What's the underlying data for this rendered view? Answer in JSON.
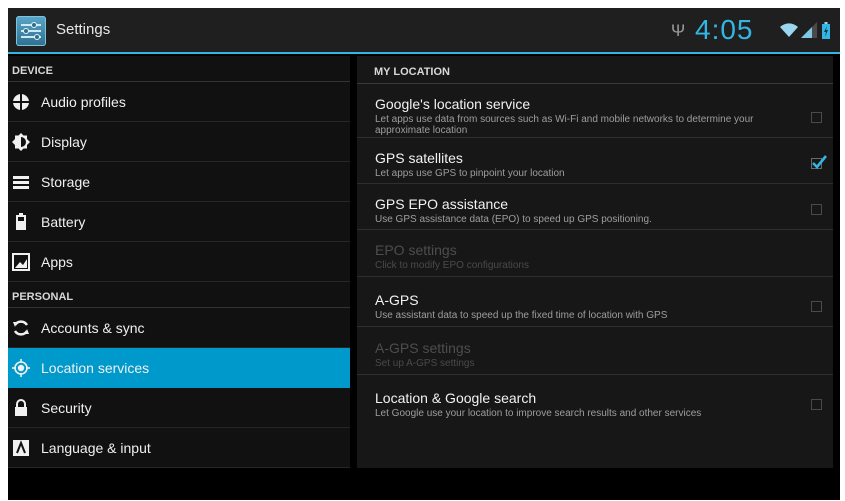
{
  "app_bar": {
    "title": "Settings",
    "app_icon": "settings-sliders-icon",
    "time": "4:05",
    "status_icons": [
      "usb-icon",
      "wifi-icon",
      "signal-icon",
      "battery-icon"
    ],
    "accent_color": "#33b5e5"
  },
  "sidebar": {
    "sections": [
      {
        "header": "DEVICE",
        "items": [
          {
            "label": "Audio profiles",
            "icon": "audio-profiles-icon"
          },
          {
            "label": "Display",
            "icon": "display-icon"
          },
          {
            "label": "Storage",
            "icon": "storage-icon"
          },
          {
            "label": "Battery",
            "icon": "battery-icon"
          },
          {
            "label": "Apps",
            "icon": "apps-icon"
          }
        ]
      },
      {
        "header": "PERSONAL",
        "items": [
          {
            "label": "Accounts & sync",
            "icon": "sync-icon"
          },
          {
            "label": "Location services",
            "icon": "location-icon",
            "selected": true
          },
          {
            "label": "Security",
            "icon": "lock-icon"
          },
          {
            "label": "Language & input",
            "icon": "keyboard-icon"
          }
        ]
      }
    ],
    "selected_color": "#0099cc"
  },
  "content": {
    "section_header": "MY LOCATION",
    "prefs": [
      {
        "title": "Google's location service",
        "summary": "Let apps use data from sources such as Wi-Fi and mobile networks to determine your approximate location",
        "checkbox": true,
        "checked": false,
        "enabled": true
      },
      {
        "title": "GPS satellites",
        "summary": "Let apps use GPS to pinpoint your location",
        "checkbox": true,
        "checked": true,
        "enabled": true
      },
      {
        "title": "GPS EPO assistance",
        "summary": "Use GPS assistance data (EPO) to speed up GPS positioning.",
        "checkbox": true,
        "checked": false,
        "enabled": true
      },
      {
        "title": "EPO settings",
        "summary": "Click to modify EPO configurations",
        "checkbox": false,
        "enabled": false
      },
      {
        "title": "A-GPS",
        "summary": "Use assistant data to speed up the fixed time of location with GPS",
        "checkbox": true,
        "checked": false,
        "enabled": true
      },
      {
        "title": "A-GPS settings",
        "summary": "Set up A-GPS settings",
        "checkbox": false,
        "enabled": false
      },
      {
        "title": "Location & Google search",
        "summary": "Let Google use your location to improve search results and other services",
        "checkbox": true,
        "checked": false,
        "enabled": true
      }
    ]
  }
}
